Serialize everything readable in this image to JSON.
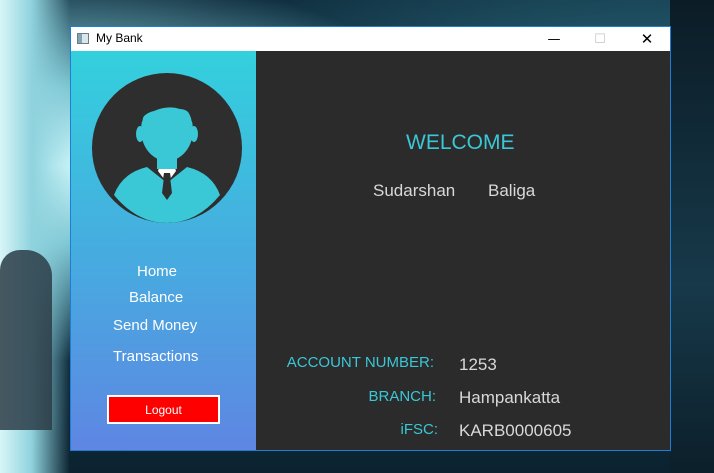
{
  "window": {
    "title": "My Bank",
    "controls": {
      "minimize": "—",
      "maximize": "☐",
      "close": "✕"
    }
  },
  "sidebar": {
    "avatar_icon": "user-avatar-icon",
    "nav": [
      {
        "label": "Home"
      },
      {
        "label": "Balance"
      },
      {
        "label": "Send Money"
      },
      {
        "label": "Transactions"
      }
    ],
    "logout_label": "Logout",
    "colors": {
      "gradient_top": "#33d0dd",
      "gradient_bottom": "#5e86e2",
      "logout_bg": "#ff0000"
    }
  },
  "main": {
    "welcome": "WELCOME",
    "first_name": "Sudarshan",
    "last_name": "Baliga",
    "account_number_label": "ACCOUNT NUMBER:",
    "account_number": "1253",
    "branch_label": "BRANCH:",
    "branch": "Hampankatta",
    "ifsc_label": "iFSC:",
    "ifsc": "KARB0000605",
    "colors": {
      "background": "#2b2b2b",
      "accent": "#3ac7d6",
      "text": "#d8d8d8"
    }
  }
}
